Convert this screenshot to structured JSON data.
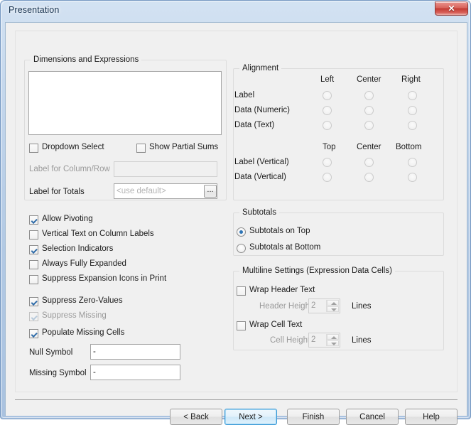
{
  "window": {
    "title": "Presentation",
    "close_label": "✕",
    "close_icon": "close-icon"
  },
  "dimensions_group": {
    "title": "Dimensions and Expressions",
    "list_items": [],
    "dropdown_select": {
      "label": "Dropdown Select",
      "checked": false,
      "disabled": false
    },
    "show_partial_sums": {
      "label": "Show Partial Sums",
      "checked": false,
      "disabled": false
    },
    "label_for_column_row": {
      "label": "Label for Column/Row",
      "value": "",
      "placeholder": "",
      "disabled": true
    },
    "label_for_totals": {
      "label": "Label for Totals",
      "value": "",
      "placeholder": "<use default>",
      "browse_label": "...",
      "disabled": false
    }
  },
  "alignment_group": {
    "title": "Alignment",
    "horizontal_headers": [
      "Left",
      "Center",
      "Right"
    ],
    "horizontal_rows": [
      {
        "label": "Label",
        "selected": null,
        "disabled": true
      },
      {
        "label": "Data (Numeric)",
        "selected": null,
        "disabled": true
      },
      {
        "label": "Data (Text)",
        "selected": null,
        "disabled": true
      }
    ],
    "vertical_headers": [
      "Top",
      "Center",
      "Bottom"
    ],
    "vertical_rows": [
      {
        "label": "Label (Vertical)",
        "selected": null,
        "disabled": true
      },
      {
        "label": "Data (Vertical)",
        "selected": null,
        "disabled": true
      }
    ]
  },
  "options": [
    {
      "label": "Allow Pivoting",
      "checked": true,
      "disabled": false
    },
    {
      "label": "Vertical Text on Column Labels",
      "checked": false,
      "disabled": false
    },
    {
      "label": "Selection Indicators",
      "checked": true,
      "disabled": false
    },
    {
      "label": "Always Fully Expanded",
      "checked": false,
      "disabled": false
    },
    {
      "label": "Suppress Expansion Icons in Print",
      "checked": false,
      "disabled": false
    },
    {
      "label": "Suppress Zero-Values",
      "checked": true,
      "disabled": false
    },
    {
      "label": "Suppress Missing",
      "checked": true,
      "disabled": true
    },
    {
      "label": "Populate Missing Cells",
      "checked": true,
      "disabled": false
    }
  ],
  "symbols": {
    "null_symbol": {
      "label": "Null Symbol",
      "value": "-"
    },
    "missing_symbol": {
      "label": "Missing Symbol",
      "value": "-"
    }
  },
  "subtotals_group": {
    "title": "Subtotals",
    "options": [
      {
        "label": "Subtotals on Top",
        "selected": true
      },
      {
        "label": "Subtotals at Bottom",
        "selected": false
      }
    ]
  },
  "multiline_group": {
    "title": "Multiline Settings (Expression Data Cells)",
    "wrap_header_text": {
      "label": "Wrap Header Text",
      "checked": false
    },
    "header_height": {
      "label": "Header Height",
      "value": "2",
      "units": "Lines",
      "disabled": true
    },
    "wrap_cell_text": {
      "label": "Wrap Cell Text",
      "checked": false
    },
    "cell_height": {
      "label": "Cell Height",
      "value": "2",
      "units": "Lines",
      "disabled": true
    }
  },
  "buttons": {
    "back": "< Back",
    "next": "Next >",
    "finish": "Finish",
    "cancel": "Cancel",
    "help": "Help"
  },
  "colors": {
    "accent": "#2e74b5",
    "focus": "#3c9ad6",
    "titlebar": "#c3d6ec",
    "client_bg": "#f0f0f0",
    "close_button": "#c23b33"
  }
}
